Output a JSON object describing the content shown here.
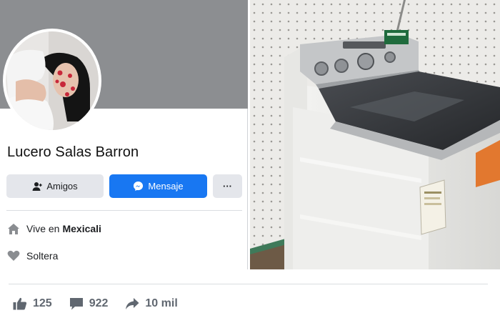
{
  "profile": {
    "name": "Lucero Salas Barron",
    "buttons": {
      "friends_label": "Amigos",
      "message_label": "Mensaje",
      "more_label": "···"
    },
    "info": {
      "lives_prefix": "Vive en",
      "city": "Mexicali",
      "relationship": "Soltera"
    },
    "icons": {
      "friends": "person-icon",
      "message": "messenger-icon",
      "home": "home-icon",
      "heart": "heart-icon"
    }
  },
  "post_stats": {
    "likes": "125",
    "comments": "922",
    "shares": "10 mil",
    "icons": {
      "likes": "thumbs-up-icon",
      "comments": "comment-icon",
      "shares": "share-arrow-icon"
    }
  },
  "colors": {
    "messenger_blue": "#1877f2",
    "button_gray": "#e4e6eb",
    "cover_gray": "#8c8e91",
    "stats_text": "#606770"
  }
}
